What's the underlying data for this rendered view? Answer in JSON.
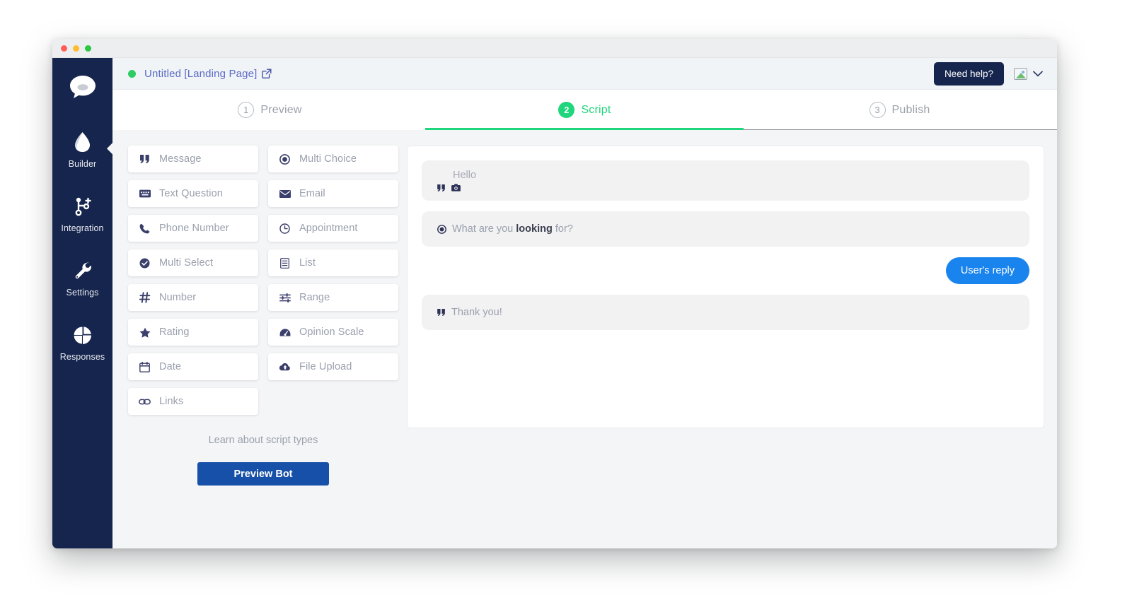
{
  "window": {
    "traffic_lights": [
      "close",
      "minimize",
      "maximize"
    ]
  },
  "sidebar": {
    "logo_icon": "chat-bubble-icon",
    "items": [
      {
        "label": "Builder",
        "icon": "water-drop-icon",
        "active": true
      },
      {
        "label": "Integration",
        "icon": "git-branch-plus-icon",
        "active": false
      },
      {
        "label": "Settings",
        "icon": "wrench-icon",
        "active": false
      },
      {
        "label": "Responses",
        "icon": "pie-chart-icon",
        "active": false
      }
    ]
  },
  "topbar": {
    "status": "online",
    "title": "Untitled [Landing Page]",
    "external_link_icon": "external-link-icon",
    "need_help_label": "Need help?",
    "avatar_icon": "broken-image-icon",
    "chevron_icon": "chevron-down-icon"
  },
  "tabs": [
    {
      "number": "1",
      "label": "Preview",
      "active": false
    },
    {
      "number": "2",
      "label": "Script",
      "active": true
    },
    {
      "number": "3",
      "label": "Publish",
      "active": false
    }
  ],
  "script_types": [
    {
      "label": "Message",
      "icon": "quote-icon"
    },
    {
      "label": "Multi Choice",
      "icon": "radio-button-icon"
    },
    {
      "label": "Text Question",
      "icon": "keyboard-icon"
    },
    {
      "label": "Email",
      "icon": "envelope-icon"
    },
    {
      "label": "Phone Number",
      "icon": "phone-icon"
    },
    {
      "label": "Appointment",
      "icon": "clock-icon"
    },
    {
      "label": "Multi Select",
      "icon": "check-circle-icon"
    },
    {
      "label": "List",
      "icon": "list-icon"
    },
    {
      "label": "Number",
      "icon": "hash-icon"
    },
    {
      "label": "Range",
      "icon": "sliders-icon"
    },
    {
      "label": "Rating",
      "icon": "star-icon"
    },
    {
      "label": "Opinion Scale",
      "icon": "gauge-icon"
    },
    {
      "label": "Date",
      "icon": "calendar-icon"
    },
    {
      "label": "File Upload",
      "icon": "cloud-upload-icon"
    },
    {
      "label": "Links",
      "icon": "link-icon"
    }
  ],
  "side_actions": {
    "learn_link": "Learn about script types",
    "preview_button": "Preview Bot"
  },
  "script_canvas": {
    "messages": [
      {
        "type": "bot",
        "text": "Hello",
        "icons": [
          "quote-icon",
          "camera-icon"
        ]
      },
      {
        "type": "bot_question",
        "icon": "radio-button-icon",
        "text_before": "What are you ",
        "text_bold": "looking",
        "text_after": " for?"
      },
      {
        "type": "user",
        "text": "User's reply"
      },
      {
        "type": "bot_inline",
        "icon": "quote-icon",
        "text": "Thank you!"
      }
    ]
  },
  "colors": {
    "sidebar": "#16254d",
    "accent_green": "#1fd67c",
    "status_green": "#2ecc62",
    "title_blue": "#5b6bc6",
    "user_bubble_blue": "#1a84ee",
    "preview_button_blue": "#1650a8",
    "need_help_navy": "#16254d"
  }
}
